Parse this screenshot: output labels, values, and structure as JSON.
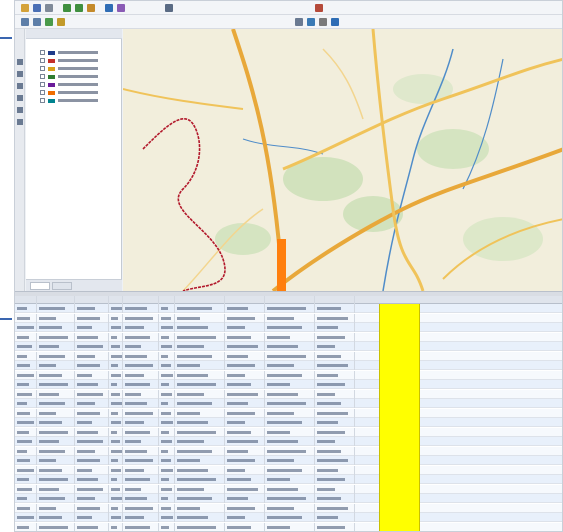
{
  "app": {
    "title": ""
  },
  "toolbar": {
    "rows": [
      {
        "icons": [
          "open-file-icon",
          "save-icon",
          "print-icon",
          "zoom-in-icon",
          "zoom-out-icon",
          "pan-icon",
          "identify-icon",
          "measure-icon",
          "select-icon",
          "layer-icon"
        ]
      },
      {
        "icons": [
          "back-icon",
          "forward-icon",
          "refresh-icon",
          "filter-icon",
          "table-icon",
          "export-icon",
          "settings-icon",
          "help-icon"
        ]
      }
    ]
  },
  "layer_panel": {
    "title": "",
    "layers": [
      {
        "label": "",
        "color": "#1f3b8a"
      },
      {
        "label": "",
        "color": "#c4302b"
      },
      {
        "label": "",
        "color": "#d9a31a"
      },
      {
        "label": "",
        "color": "#2e7d32"
      },
      {
        "label": "",
        "color": "#6a1b9a"
      },
      {
        "label": "",
        "color": "#ef6c00"
      },
      {
        "label": "",
        "color": "#00838f"
      }
    ],
    "bottom_tabs": [
      "",
      ""
    ]
  },
  "map": {
    "colors": {
      "background": "#f2eedc",
      "road": "#f0c35a",
      "road_major": "#e8a83a",
      "boundary": "#b2182b",
      "river": "#4f8cc9",
      "forest": "#c9dfb5",
      "highlight": "#ff7f0e"
    }
  },
  "table": {
    "columns": [
      "",
      "",
      "",
      "",
      "",
      "",
      "",
      "",
      "",
      "",
      ""
    ],
    "rows": [
      [
        "",
        "",
        "",
        "",
        "",
        "",
        "",
        "",
        "",
        "",
        ""
      ],
      [
        "",
        "",
        "",
        "",
        "",
        "",
        "",
        "",
        "",
        "",
        ""
      ],
      [
        "",
        "",
        "",
        "",
        "",
        "",
        "",
        "",
        "",
        "",
        ""
      ],
      [
        "",
        "",
        "",
        "",
        "",
        "",
        "",
        "",
        "",
        "",
        ""
      ],
      [
        "",
        "",
        "",
        "",
        "",
        "",
        "",
        "",
        "",
        "",
        ""
      ],
      [
        "",
        "",
        "",
        "",
        "",
        "",
        "",
        "",
        "",
        "",
        ""
      ],
      [
        "",
        "",
        "",
        "",
        "",
        "",
        "",
        "",
        "",
        "",
        ""
      ],
      [
        "",
        "",
        "",
        "",
        "",
        "",
        "",
        "",
        "",
        "",
        ""
      ],
      [
        "",
        "",
        "",
        "",
        "",
        "",
        "",
        "",
        "",
        "",
        ""
      ],
      [
        "",
        "",
        "",
        "",
        "",
        "",
        "",
        "",
        "",
        "",
        ""
      ],
      [
        "",
        "",
        "",
        "",
        "",
        "",
        "",
        "",
        "",
        "",
        ""
      ],
      [
        "",
        "",
        "",
        "",
        "",
        "",
        "",
        "",
        "",
        "",
        ""
      ],
      [
        "",
        "",
        "",
        "",
        "",
        "",
        "",
        "",
        "",
        "",
        ""
      ],
      [
        "",
        "",
        "",
        "",
        "",
        "",
        "",
        "",
        "",
        "",
        ""
      ],
      [
        "",
        "",
        "",
        "",
        "",
        "",
        "",
        "",
        "",
        "",
        ""
      ],
      [
        "",
        "",
        "",
        "",
        "",
        "",
        "",
        "",
        "",
        "",
        ""
      ],
      [
        "",
        "",
        "",
        "",
        "",
        "",
        "",
        "",
        "",
        "",
        ""
      ],
      [
        "",
        "",
        "",
        "",
        "",
        "",
        "",
        "",
        "",
        "",
        ""
      ],
      [
        "",
        "",
        "",
        "",
        "",
        "",
        "",
        "",
        "",
        "",
        ""
      ],
      [
        "",
        "",
        "",
        "",
        "",
        "",
        "",
        "",
        "",
        "",
        ""
      ],
      [
        "",
        "",
        "",
        "",
        "",
        "",
        "",
        "",
        "",
        "",
        ""
      ],
      [
        "",
        "",
        "",
        "",
        "",
        "",
        "",
        "",
        "",
        "",
        ""
      ],
      [
        "",
        "",
        "",
        "",
        "",
        "",
        "",
        "",
        "",
        "",
        ""
      ],
      [
        "",
        "",
        "",
        "",
        "",
        "",
        "",
        "",
        "",
        "",
        ""
      ]
    ],
    "highlight_color": "#ffff00"
  }
}
